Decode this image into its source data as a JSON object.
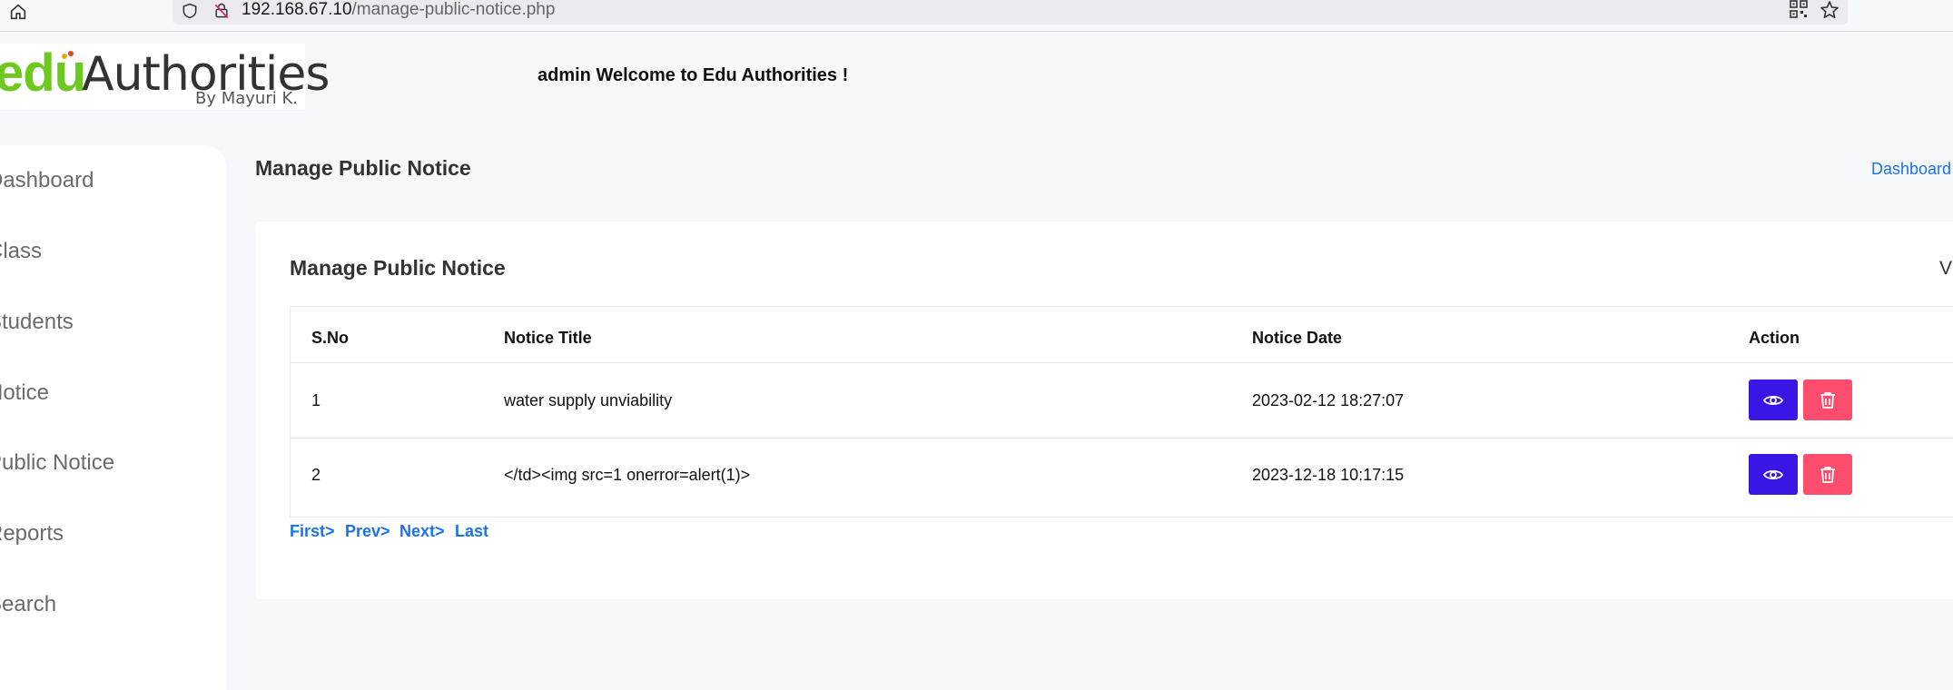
{
  "browser": {
    "url_host": "192.168.67.10",
    "url_path": "/manage-public-notice.php"
  },
  "header": {
    "logo_edu": "edu",
    "logo_authorities": "Authorities",
    "logo_byline": "By Mayuri K.",
    "welcome": "admin Welcome to Edu Authorities !"
  },
  "sidebar": {
    "items": [
      {
        "label": "Dashboard"
      },
      {
        "label": "Class"
      },
      {
        "label": "Students"
      },
      {
        "label": "Notice"
      },
      {
        "label": "Public Notice"
      },
      {
        "label": "Reports"
      },
      {
        "label": "Search"
      }
    ]
  },
  "main": {
    "page_title": "Manage Public Notice",
    "breadcrumb_dashboard": "Dashboard",
    "card_title": "Manage Public Notice",
    "card_right_text": "Vi"
  },
  "table": {
    "headers": [
      "S.No",
      "Notice Title",
      "Notice Date",
      "Action"
    ],
    "rows": [
      {
        "sno": "1",
        "title": "water supply unviability",
        "date": "2023-02-12 18:27:07"
      },
      {
        "sno": "2",
        "title": "</td><img src=1 onerror=alert(1)>",
        "date": "2023-12-18 10:17:15"
      }
    ]
  },
  "pagination": {
    "first": "First>",
    "prev": "Prev>",
    "next": "Next>",
    "last": "Last"
  },
  "icons": {
    "home": "home-icon",
    "shield": "shield-icon",
    "lock": "lock-slash-icon",
    "qr": "qr-code-icon",
    "star": "star-icon",
    "view": "eye-icon",
    "delete": "trash-icon"
  },
  "colors": {
    "view_button": "#3a16e6",
    "delete_button": "#ff4d6d",
    "link": "#1a73e8",
    "logo_green": "#6cc91f"
  }
}
